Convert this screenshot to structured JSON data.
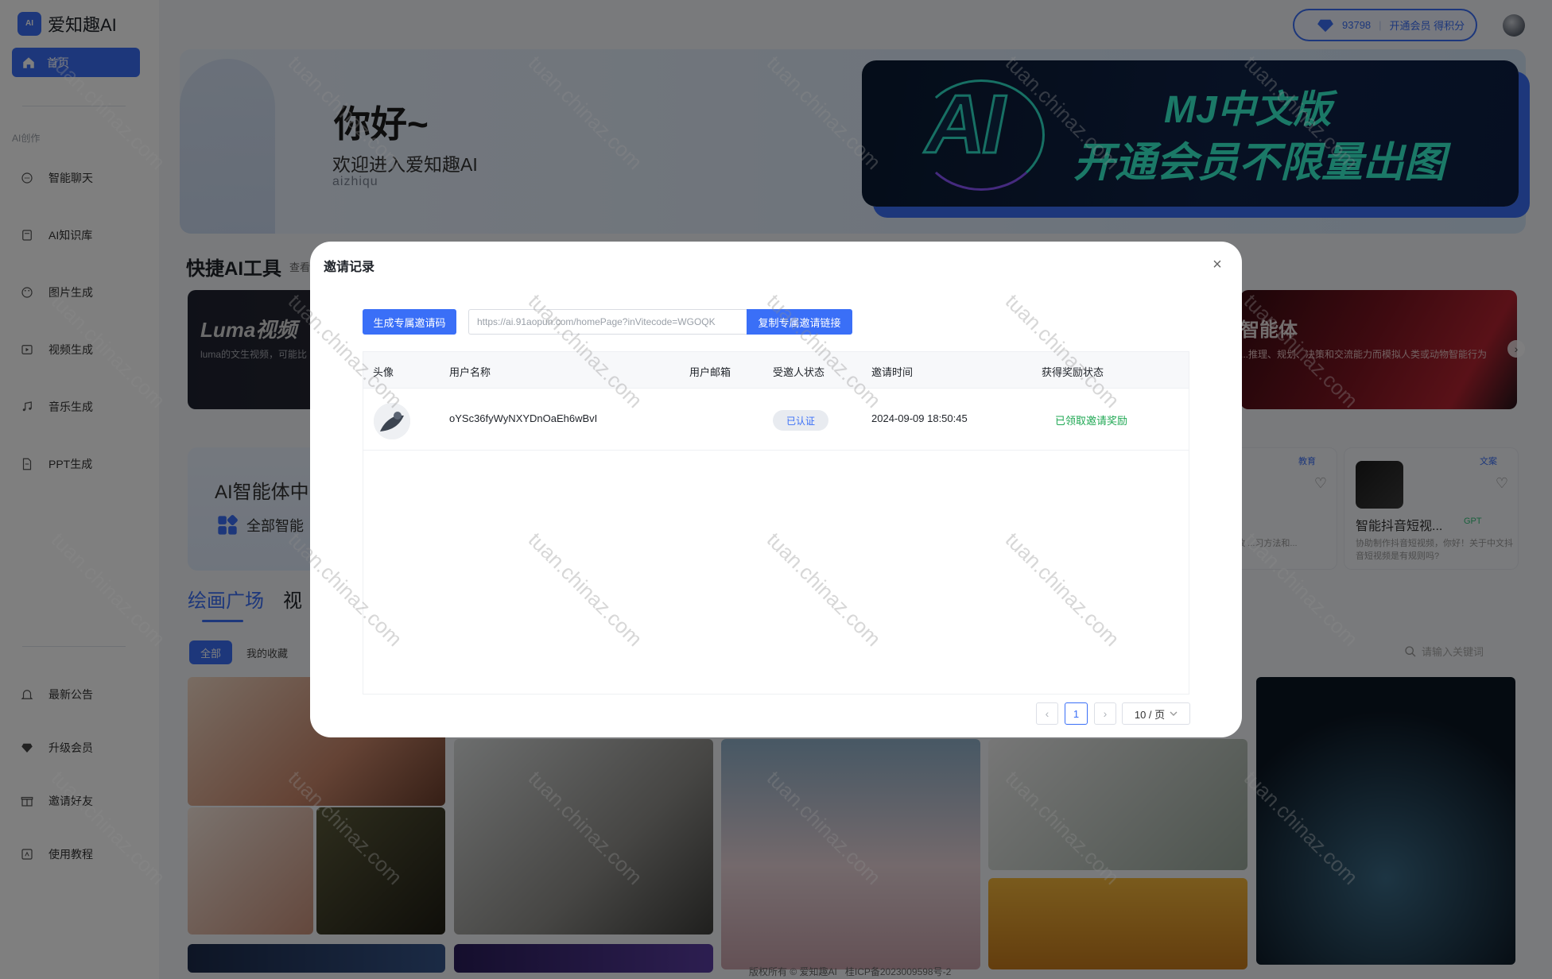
{
  "app": {
    "logo_mark": "AI",
    "logo_text": "爱知趣AI"
  },
  "sidebar": {
    "home_label": "首页",
    "section_label": "AI创作",
    "items": [
      {
        "label": "智能聊天",
        "icon": "chat-icon"
      },
      {
        "label": "AI知识库",
        "icon": "book-icon"
      },
      {
        "label": "图片生成",
        "icon": "palette-icon"
      },
      {
        "label": "视频生成",
        "icon": "video-icon"
      },
      {
        "label": "音乐生成",
        "icon": "music-icon"
      },
      {
        "label": "PPT生成",
        "icon": "document-icon"
      }
    ],
    "bottom_items": [
      {
        "label": "最新公告",
        "icon": "bell-icon"
      },
      {
        "label": "升级会员",
        "icon": "diamond-icon"
      },
      {
        "label": "邀请好友",
        "icon": "gift-icon"
      },
      {
        "label": "使用教程",
        "icon": "tutorial-icon"
      }
    ]
  },
  "header": {
    "points": "93798",
    "vip_label": "开通会员 得积分"
  },
  "banner": {
    "hello": "你好~",
    "welcome": "欢迎进入爱知趣AI",
    "welcome_en": "aizhiqu",
    "ad_line1": "MJ中文版",
    "ad_line2": "开通会员不限量出图",
    "ad_logo": "AI"
  },
  "quick_tools": {
    "title": "快捷AI工具",
    "more": "查看",
    "luma_title": "Luma视频",
    "luma_desc": "luma的文生视频，可能比",
    "agent_title": "智能体",
    "agent_desc": "...推理、规划、决策和交流能力而模拟人类或动物智能行为"
  },
  "agents": {
    "title": "AI智能体中",
    "all_label": "全部智能",
    "card_a": {
      "tag": "教育",
      "desc": "...字学习教 ...习方法和..."
    },
    "card_b": {
      "tag": "文案",
      "title": "智能抖音短视...",
      "badge": "GPT",
      "desc": "协助制作抖音短视频，你好！关于中文抖音短视频是有规则吗?"
    }
  },
  "gallery": {
    "tab_active": "绘画广场",
    "tab_other": "视",
    "chip_all": "全部",
    "chip_fav": "我的收藏",
    "search_placeholder": "请输入关键词"
  },
  "footer": {
    "copyright": "版权所有 © 爱知趣AI",
    "icp": "桂ICP备2023009598号-2"
  },
  "modal": {
    "title": "邀请记录",
    "gen_button": "生成专属邀请码",
    "invite_link": "https://ai.91aopun.com/homePage?inVitecode=WGOQK",
    "copy_button": "复制专属邀请链接",
    "columns": [
      "头像",
      "用户名称",
      "用户邮箱",
      "受邀人状态",
      "邀请时间",
      "获得奖励状态"
    ],
    "rows": [
      {
        "username": "oYSc36fyWyNXYDnOaEh6wBvI",
        "email": "",
        "status": "已认证",
        "time": "2024-09-09 18:50:45",
        "reward": "已领取邀请奖励"
      }
    ],
    "pagination": {
      "current": "1",
      "page_size": "10 / 页"
    }
  },
  "watermark": "tuan.chinaz.com",
  "colors": {
    "accent": "#3a6ff7",
    "reward_green": "#20a854",
    "overlay": "rgba(0,0,0,0.5)"
  }
}
